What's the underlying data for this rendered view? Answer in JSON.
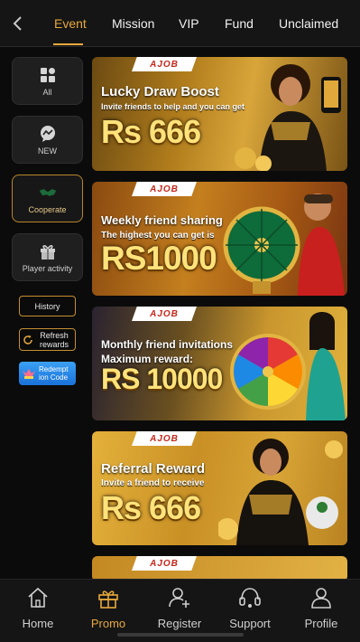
{
  "tabs": [
    {
      "label": "Event"
    },
    {
      "label": "Mission"
    },
    {
      "label": "VIP"
    },
    {
      "label": "Fund"
    },
    {
      "label": "Unclaimed"
    }
  ],
  "categories": [
    {
      "label": "All",
      "icon": "grid-icon"
    },
    {
      "label": "NEW",
      "icon": "chat-icon"
    },
    {
      "label": "Cooperate",
      "icon": "handshake-icon"
    },
    {
      "label": "Player activity",
      "icon": "gift-icon"
    }
  ],
  "side_buttons": {
    "history": "History",
    "refresh": "Refresh rewards",
    "redeem": "Redempt ion Code"
  },
  "banners": [
    {
      "brand": "AJOB",
      "title": "Lucky Draw Boost",
      "subtitle": "Invite friends to help and you can get",
      "amount": "Rs 666"
    },
    {
      "brand": "AJOB",
      "title": "Weekly friend sharing",
      "subtitle": "The highest you can get is",
      "amount": "RS1000"
    },
    {
      "brand": "AJOB",
      "title": "Monthly friend invitations",
      "subtitle": "Maximum reward:",
      "amount": "RS 10000"
    },
    {
      "brand": "AJOB",
      "title": "Referral Reward",
      "subtitle": "Invite a friend to receive",
      "amount": "Rs 666"
    },
    {
      "brand": "AJOB"
    }
  ],
  "bottom_nav": [
    {
      "label": "Home",
      "icon": "home-icon"
    },
    {
      "label": "Promo",
      "icon": "gift-box-icon"
    },
    {
      "label": "Register",
      "icon": "add-user-icon"
    },
    {
      "label": "Support",
      "icon": "headset-icon"
    },
    {
      "label": "Profile",
      "icon": "user-icon"
    }
  ],
  "colors": {
    "accent": "#e7a93b",
    "background": "#0b0b0b",
    "panel": "#151515"
  }
}
